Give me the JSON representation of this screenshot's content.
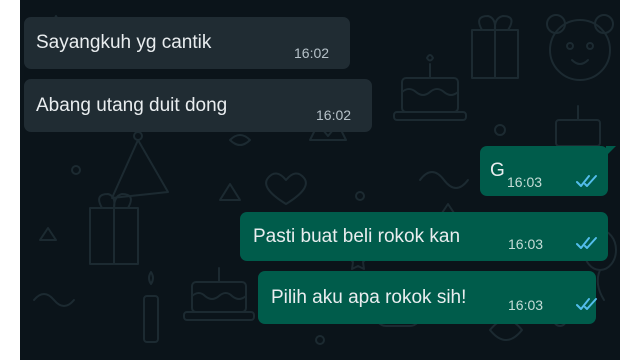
{
  "messages": [
    {
      "direction": "incoming",
      "text": "Sayangkuh yg cantik",
      "time": "16:02"
    },
    {
      "direction": "incoming",
      "text": "Abang utang duit dong",
      "time": "16:02"
    },
    {
      "direction": "outgoing",
      "text": "G",
      "time": "16:03",
      "status": "read"
    },
    {
      "direction": "outgoing",
      "text": "Pasti buat beli rokok kan",
      "time": "16:03",
      "status": "read"
    },
    {
      "direction": "outgoing",
      "text": "Pilih aku apa rokok sih!",
      "time": "16:03",
      "status": "read"
    }
  ],
  "colors": {
    "chat_background": "#0b141a",
    "incoming_bubble": "#202c33",
    "outgoing_bubble": "#005c4b",
    "read_ticks": "#53bdeb",
    "text": "#e9edef"
  },
  "icons": {
    "read_status": "double-check-icon",
    "wallpaper": "doodle-pattern"
  }
}
